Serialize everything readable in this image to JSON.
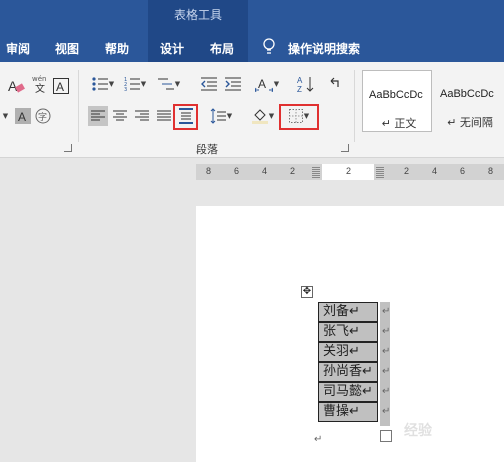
{
  "header": {
    "context_group": "表格工具",
    "tabs": [
      {
        "label": "审阅"
      },
      {
        "label": "视图"
      },
      {
        "label": "帮助"
      },
      {
        "label": "设计"
      },
      {
        "label": "布局"
      }
    ],
    "tell_me": "操作说明搜索"
  },
  "ribbon": {
    "paragraph_group_label": "段落",
    "styles": [
      {
        "sample": "AaBbCcDc",
        "name": "↵ 正文"
      },
      {
        "sample": "AaBbCcDc",
        "name": "↵ 无间隔"
      }
    ],
    "highlight_color": "#e03030",
    "accent_color": "#2b579a"
  },
  "ruler": {
    "labels": [
      "8",
      "6",
      "4",
      "2",
      "2",
      "2",
      "4",
      "6",
      "8"
    ]
  },
  "document": {
    "table_rows": [
      "刘备↵",
      "张飞↵",
      "关羽↵",
      "孙尚香↵",
      "司马懿↵",
      "曹操↵"
    ],
    "row_end_mark": "↵",
    "paragraph_end_mark": "↵",
    "watermark": "经验"
  }
}
